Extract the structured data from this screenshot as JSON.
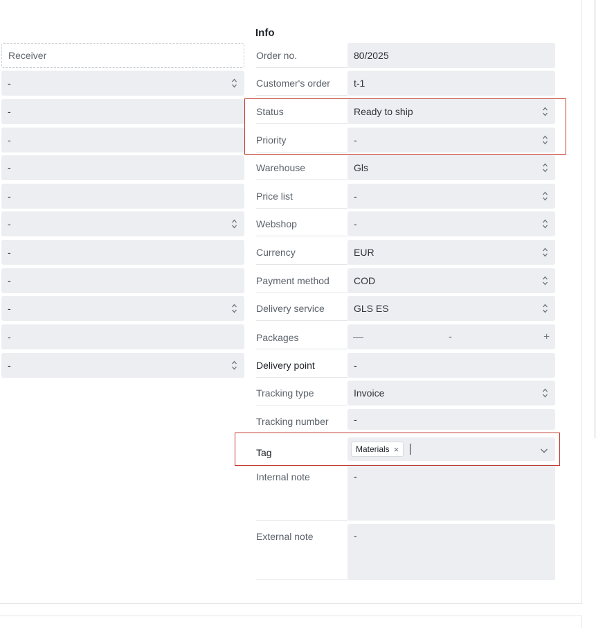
{
  "section_title": "Info",
  "left_column": {
    "receiver_placeholder": "Receiver",
    "rows": [
      {
        "value": "-",
        "select": true
      },
      {
        "value": "-",
        "select": false
      },
      {
        "value": "-",
        "select": false
      },
      {
        "value": "-",
        "select": false
      },
      {
        "value": "-",
        "select": false
      },
      {
        "value": "-",
        "select": true
      },
      {
        "value": "-",
        "select": false
      },
      {
        "value": "-",
        "select": false
      },
      {
        "value": "-",
        "select": true
      },
      {
        "value": "-",
        "select": false
      },
      {
        "value": "-",
        "select": true
      }
    ]
  },
  "fields": {
    "order_no": {
      "label": "Order no.",
      "value": "80/2025"
    },
    "customers_order": {
      "label": "Customer's order",
      "value": "t-1"
    },
    "status": {
      "label": "Status",
      "value": "Ready to ship"
    },
    "priority": {
      "label": "Priority",
      "value": "-"
    },
    "warehouse": {
      "label": "Warehouse",
      "value": "Gls"
    },
    "price_list": {
      "label": "Price list",
      "value": "-"
    },
    "webshop": {
      "label": "Webshop",
      "value": "-"
    },
    "currency": {
      "label": "Currency",
      "value": "EUR"
    },
    "payment_method": {
      "label": "Payment method",
      "value": "COD"
    },
    "delivery_service": {
      "label": "Delivery service",
      "value": "GLS ES"
    },
    "packages": {
      "label": "Packages",
      "value": "-",
      "minus": "—",
      "plus": "+"
    },
    "delivery_point": {
      "label": "Delivery point",
      "value": "-"
    },
    "tracking_type": {
      "label": "Tracking type",
      "value": "Invoice"
    },
    "tracking_number": {
      "label": "Tracking number",
      "value": "-"
    },
    "tag": {
      "label": "Tag",
      "chips": [
        "Materials"
      ],
      "remove_glyph": "×"
    },
    "internal_note": {
      "label": "Internal note",
      "value": "-"
    },
    "external_note": {
      "label": "External note",
      "value": "-"
    }
  },
  "colors": {
    "field_bg": "#eceef1",
    "highlight": "#c0392b",
    "label": "#5b616a"
  }
}
